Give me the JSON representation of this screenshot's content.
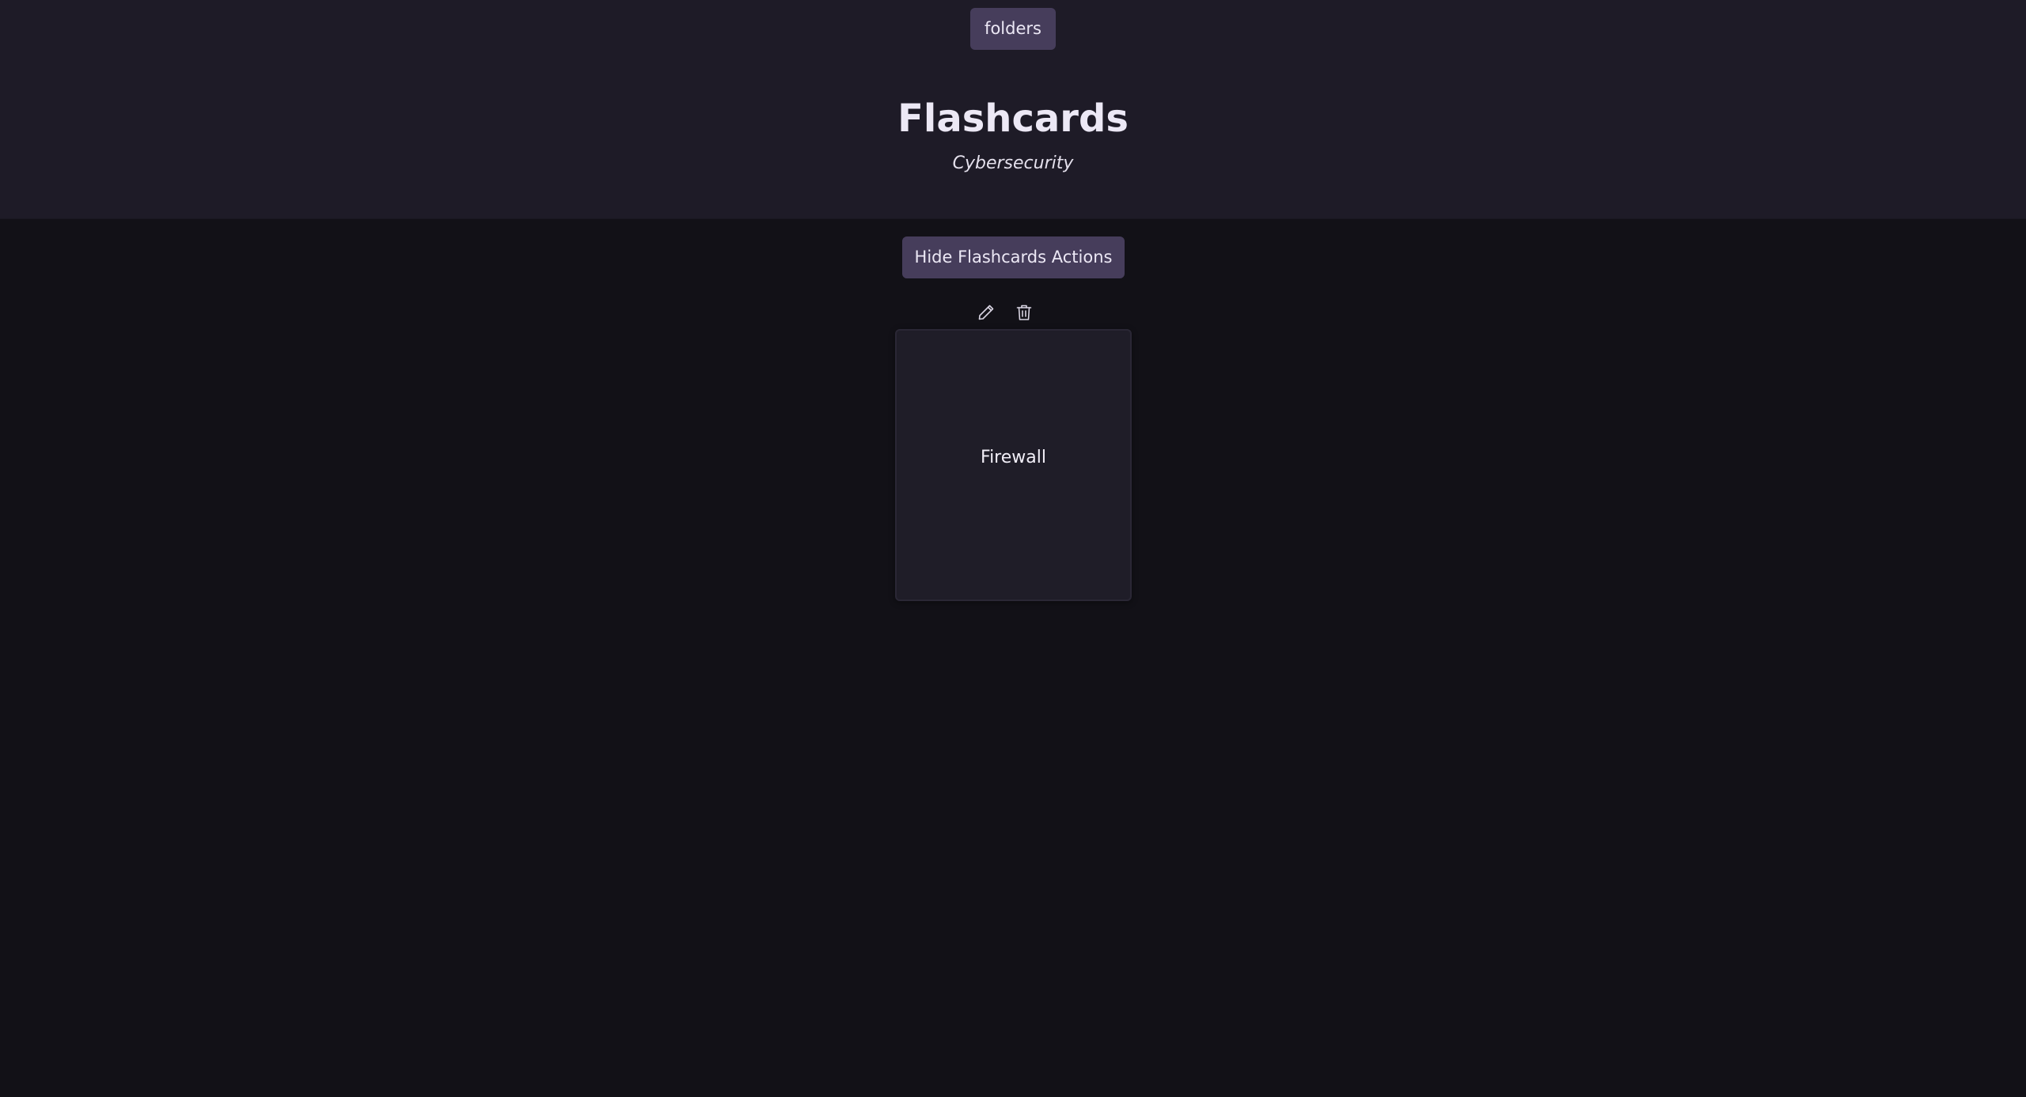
{
  "header": {
    "folders_label": "folders",
    "title": "Flashcards",
    "subtitle": "Cybersecurity"
  },
  "toolbar": {
    "toggle_actions_label": "Hide Flashcards Actions"
  },
  "card_actions": {
    "edit_icon": "pencil-icon",
    "delete_icon": "trash-icon"
  },
  "flashcards": [
    {
      "front": "Firewall"
    }
  ],
  "colors": {
    "header_bg": "#1e1b27",
    "page_bg": "#121117",
    "button_bg": "#463d5b",
    "card_bg": "#1f1d28"
  }
}
